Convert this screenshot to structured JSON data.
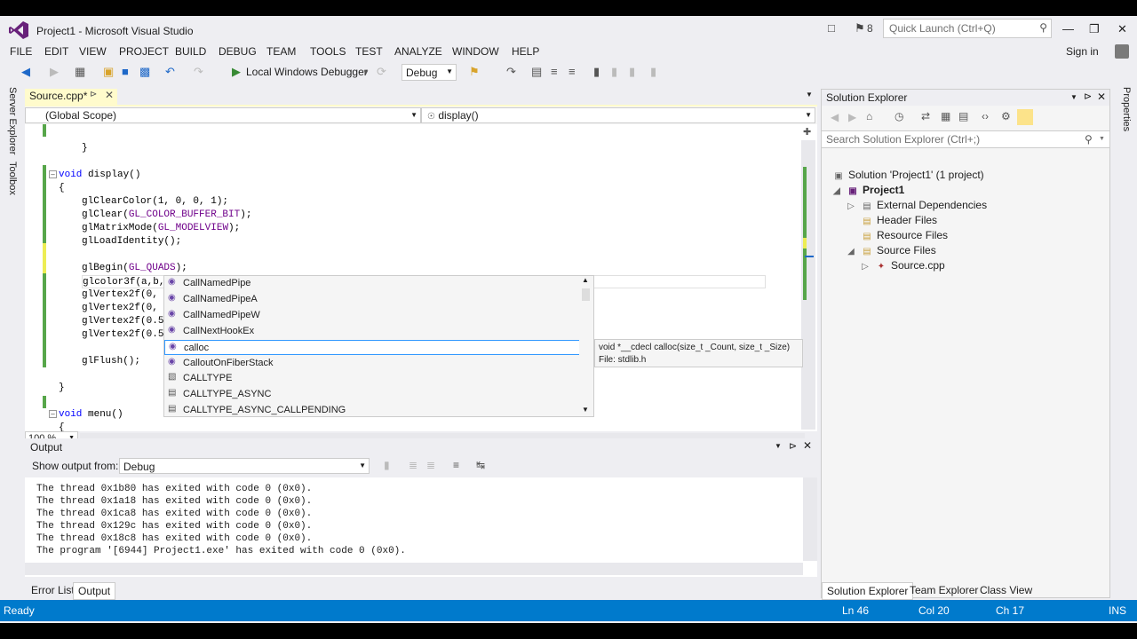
{
  "window": {
    "title": "Project1 - Microsoft Visual Studio",
    "notifications_count": "8",
    "quick_launch_placeholder": "Quick Launch (Ctrl+Q)"
  },
  "menu": {
    "items": [
      "FILE",
      "EDIT",
      "VIEW",
      "PROJECT",
      "BUILD",
      "DEBUG",
      "TEAM",
      "TOOLS",
      "TEST",
      "ANALYZE",
      "WINDOW",
      "HELP"
    ],
    "sign_in": "Sign in"
  },
  "toolbar": {
    "debugger_label": "Local Windows Debugger",
    "configuration": "Debug"
  },
  "side_tabs": {
    "left": [
      "Server Explorer",
      "Toolbox"
    ],
    "right": [
      "Properties"
    ]
  },
  "editor": {
    "tab_label": "Source.cpp*",
    "scope": "(Global Scope)",
    "function": "display()",
    "zoom": "100 %",
    "lines": [
      {
        "indent": 1,
        "text": "}"
      },
      {
        "indent": 0,
        "text": ""
      },
      {
        "indent": 0,
        "text": "void display()"
      },
      {
        "indent": 0,
        "text": "{"
      },
      {
        "indent": 1,
        "text": "glClearColor(1, 0, 0, 1);"
      },
      {
        "indent": 1,
        "text": "glClear(GL_COLOR_BUFFER_BIT);"
      },
      {
        "indent": 1,
        "text": "glMatrixMode(GL_MODELVIEW);"
      },
      {
        "indent": 1,
        "text": "glLoadIdentity();"
      },
      {
        "indent": 0,
        "text": ""
      },
      {
        "indent": 1,
        "text": "glBegin(GL_QUADS);"
      },
      {
        "indent": 1,
        "text": "glcolor3f(a,b,c);"
      },
      {
        "indent": 1,
        "text": "glVertex2f(0,"
      },
      {
        "indent": 1,
        "text": "glVertex2f(0,"
      },
      {
        "indent": 1,
        "text": "glVertex2f(0.5"
      },
      {
        "indent": 1,
        "text": "glVertex2f(0.5"
      },
      {
        "indent": 0,
        "text": ""
      },
      {
        "indent": 1,
        "text": "glFlush();"
      },
      {
        "indent": 0,
        "text": ""
      },
      {
        "indent": 0,
        "text": "}"
      },
      {
        "indent": 0,
        "text": ""
      },
      {
        "indent": 0,
        "text": "void menu()"
      },
      {
        "indent": 0,
        "text": "{"
      }
    ]
  },
  "intellisense": {
    "items": [
      {
        "label": "CallNamedPipe",
        "icon": "function-icon"
      },
      {
        "label": "CallNamedPipeA",
        "icon": "function-icon"
      },
      {
        "label": "CallNamedPipeW",
        "icon": "function-icon"
      },
      {
        "label": "CallNextHookEx",
        "icon": "function-icon"
      },
      {
        "label": "calloc",
        "icon": "function-icon",
        "selected": true
      },
      {
        "label": "CalloutOnFiberStack",
        "icon": "function-icon"
      },
      {
        "label": "CALLTYPE",
        "icon": "enum-icon"
      },
      {
        "label": "CALLTYPE_ASYNC",
        "icon": "enum-member-icon"
      },
      {
        "label": "CALLTYPE_ASYNC_CALLPENDING",
        "icon": "enum-member-icon"
      }
    ],
    "tooltip_signature": "void *__cdecl calloc(size_t _Count, size_t _Size)",
    "tooltip_file": "File: stdlib.h"
  },
  "output": {
    "title": "Output",
    "show_output_from_label": "Show output from:",
    "source": "Debug",
    "lines": [
      "The thread 0x1b80 has exited with code 0 (0x0).",
      "The thread 0x1a18 has exited with code 0 (0x0).",
      "The thread 0x1ca8 has exited with code 0 (0x0).",
      "The thread 0x129c has exited with code 0 (0x0).",
      "The thread 0x18c8 has exited with code 0 (0x0).",
      "The program '[6944] Project1.exe' has exited with code 0 (0x0)."
    ],
    "tabs": [
      "Error List",
      "Output"
    ]
  },
  "solution_explorer": {
    "title": "Solution Explorer",
    "search_placeholder": "Search Solution Explorer (Ctrl+;)",
    "tree": [
      {
        "label": "Solution 'Project1' (1 project)",
        "level": 0,
        "icon": "solution-icon"
      },
      {
        "label": "Project1",
        "level": 1,
        "icon": "project-icon",
        "expanded": true
      },
      {
        "label": "External Dependencies",
        "level": 2,
        "icon": "folder-icon",
        "expanded": false
      },
      {
        "label": "Header Files",
        "level": 2,
        "icon": "folder-icon"
      },
      {
        "label": "Resource Files",
        "level": 2,
        "icon": "folder-icon"
      },
      {
        "label": "Source Files",
        "level": 2,
        "icon": "folder-icon",
        "expanded": true
      },
      {
        "label": "Source.cpp",
        "level": 3,
        "icon": "cpp-file-icon",
        "expanded": false
      }
    ],
    "tabs": [
      "Solution Explorer",
      "Team Explorer",
      "Class View"
    ]
  },
  "status": {
    "state": "Ready",
    "line": "Ln 46",
    "col": "Col 20",
    "ch": "Ch 17",
    "mode": "INS"
  },
  "colors": {
    "status_bar": "#007acc",
    "chrome_bg": "#eeeef2",
    "keyword": "#0000ff",
    "macro": "#6f008a"
  }
}
